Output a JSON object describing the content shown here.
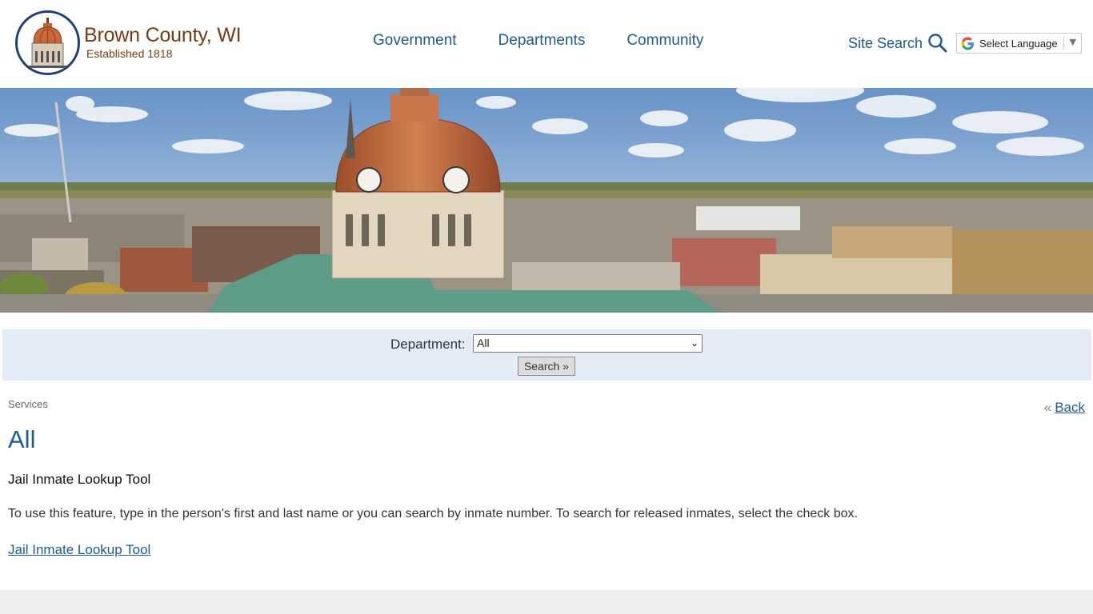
{
  "colors": {
    "brand_brown": "#7a3b12",
    "link_blue": "#1c5a99",
    "seal_blue": "#1d3f7a",
    "filter_bg": "#e3ecf7",
    "footer_bg": "#efefef"
  },
  "header": {
    "site_name": "Brown County, WI",
    "tagline": "Established 1818",
    "logo_icon": "courthouse-seal-icon",
    "nav": [
      {
        "label": "Government"
      },
      {
        "label": "Departments"
      },
      {
        "label": "Community"
      }
    ],
    "site_search_label": "Site Search",
    "site_search_icon": "magnifier-icon",
    "language_label": "Select Language",
    "language_icon": "google-g-icon"
  },
  "filter": {
    "department_label": "Department:",
    "department_selected": "All",
    "search_button": "Search »"
  },
  "content": {
    "breadcrumb": "Services",
    "back_prefix": "«",
    "back_label": "Back",
    "page_title": "All",
    "item_title": "Jail Inmate Lookup Tool",
    "item_description": "To use this feature, type in the person's first and last name or you can search by inmate number. To search for released inmates, select the check box.",
    "item_link": "Jail Inmate Lookup Tool"
  }
}
